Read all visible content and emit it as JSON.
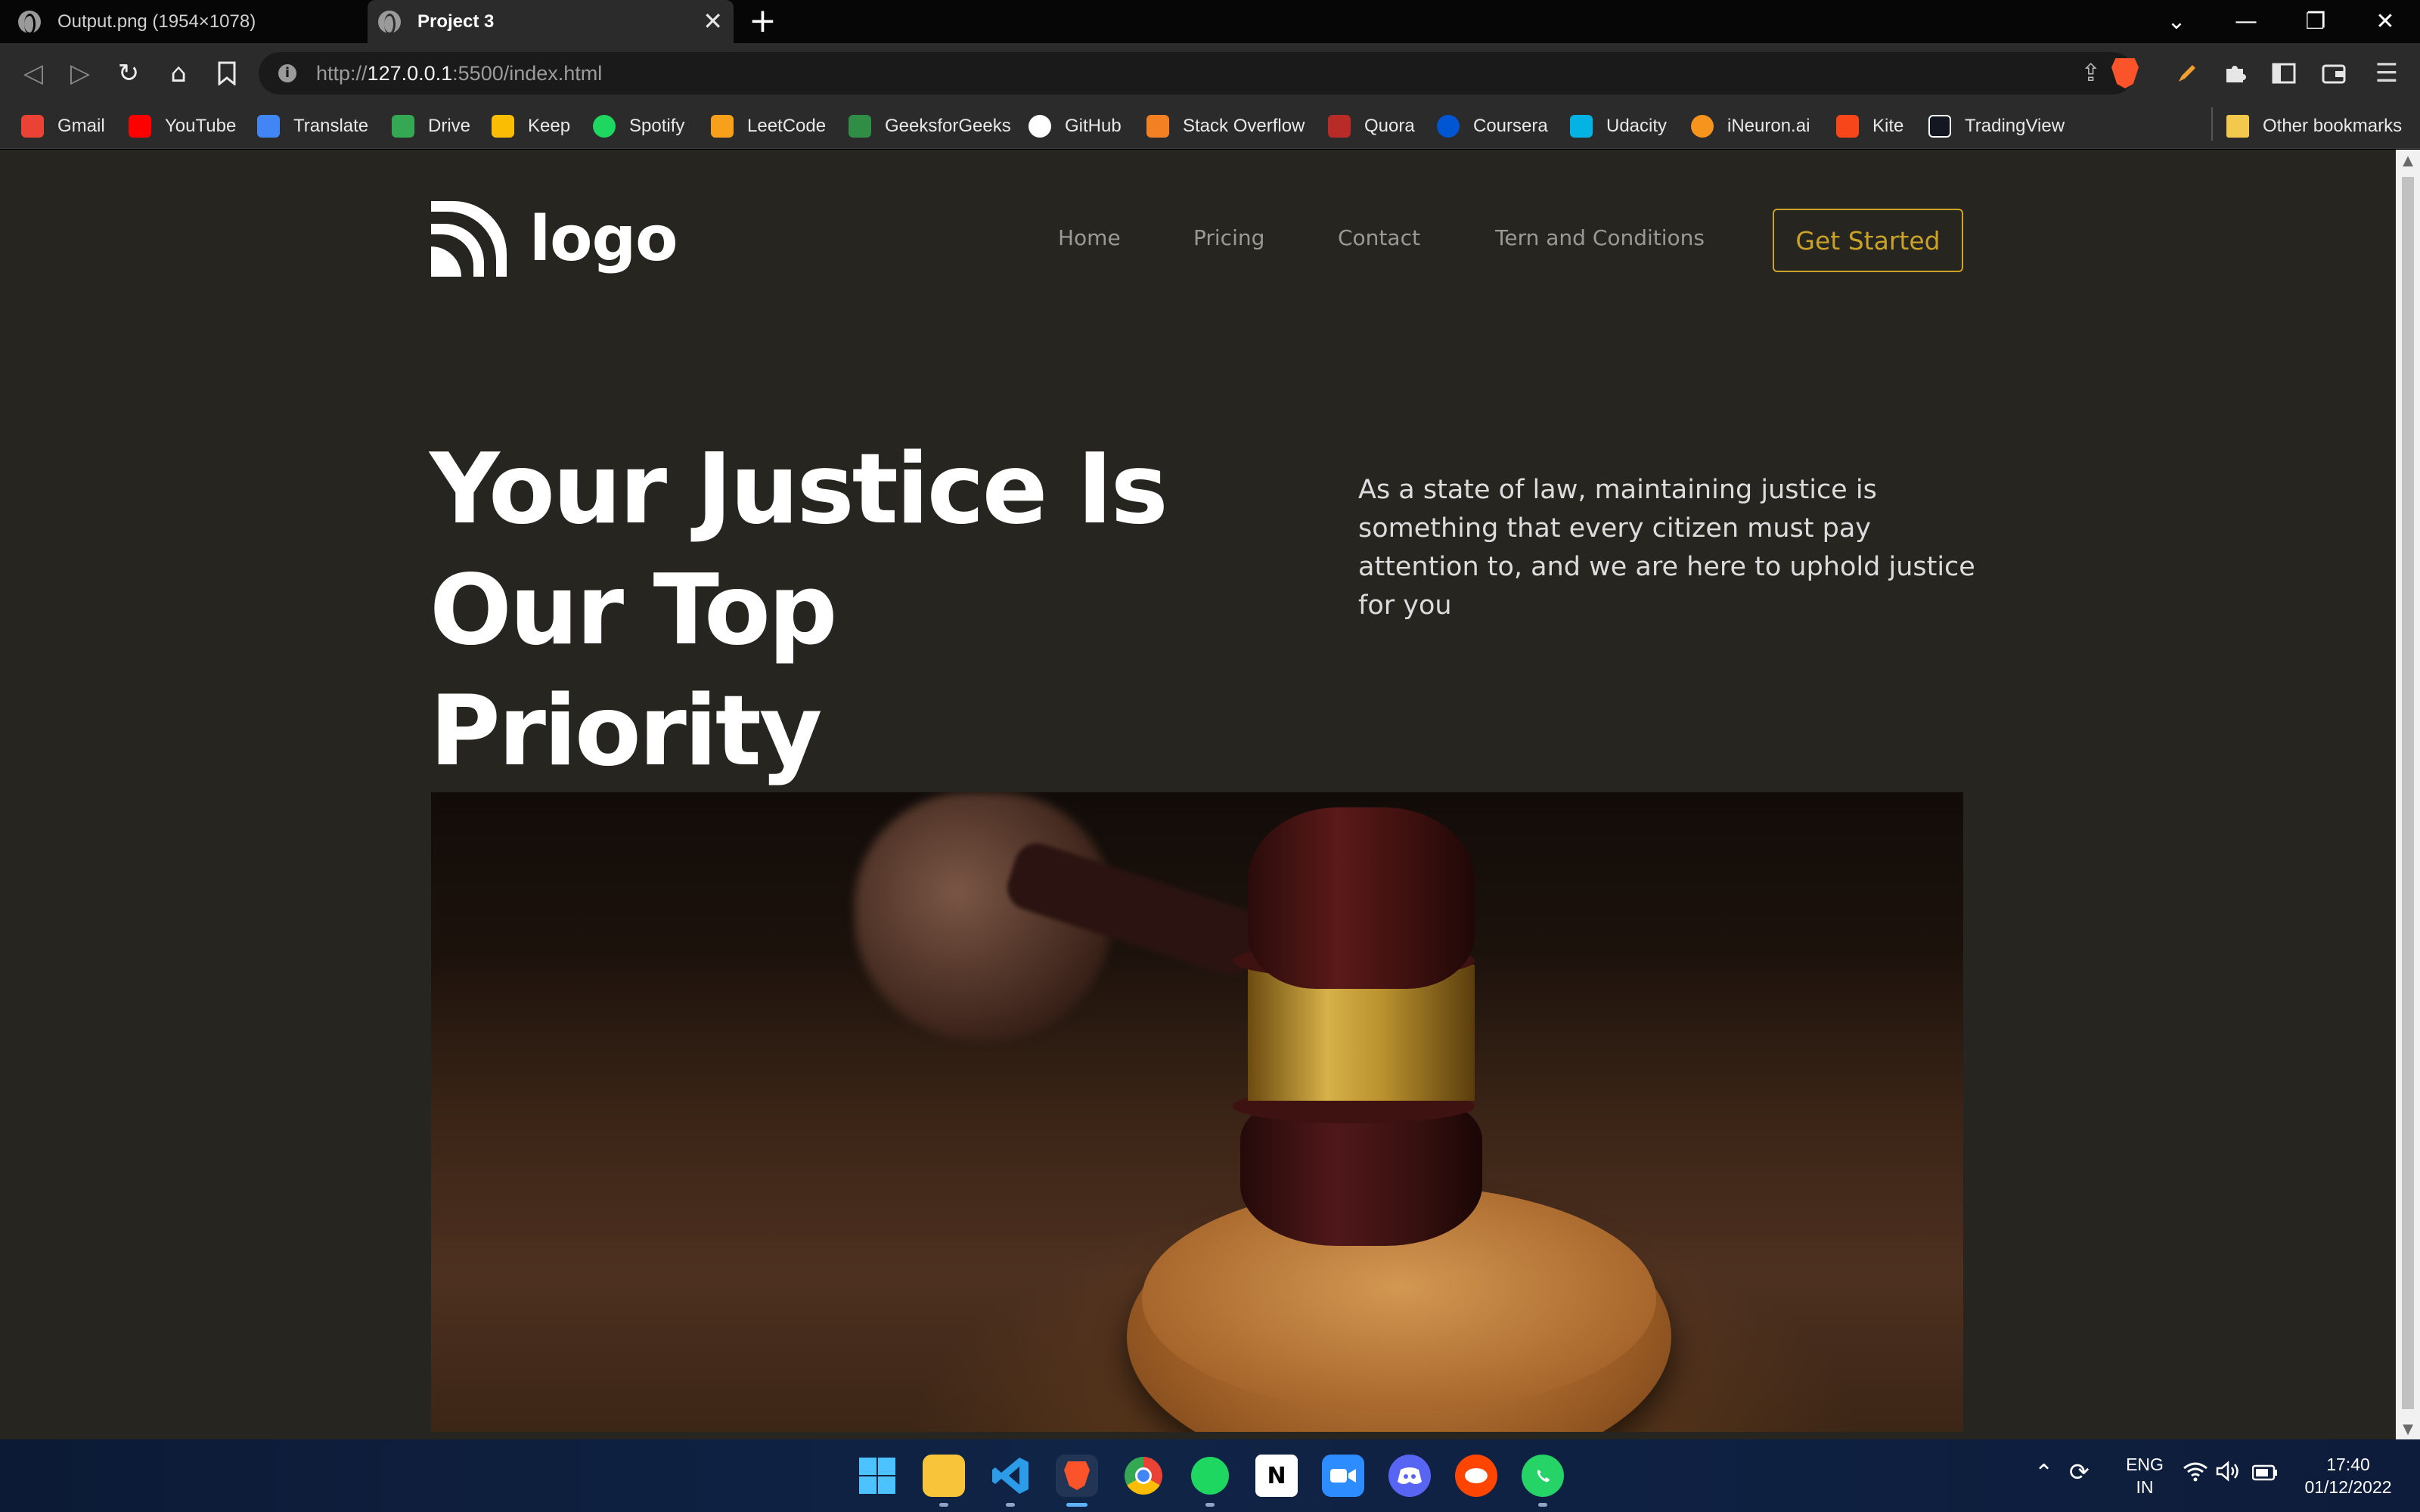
{
  "tabs": [
    {
      "title": "Output.png (1954×1078)",
      "active": false
    },
    {
      "title": "Project 3",
      "active": true
    }
  ],
  "tab_close": "✕",
  "new_tab": "+",
  "window_controls": {
    "dropdown": "⌄",
    "minimize": "—",
    "restore": "❐",
    "close": "✕"
  },
  "address": {
    "host": "127.0.0.1",
    "prefix": "http://",
    "suffix": ":5500/index.html"
  },
  "toolbar_icons": {
    "back": "◁",
    "forward": "▷",
    "reload": "↻",
    "home": "⌂",
    "bookmark": "🔖",
    "share": "⇪",
    "menu": "☰"
  },
  "bookmarks": [
    {
      "label": "Gmail",
      "color": "#ea4335"
    },
    {
      "label": "YouTube",
      "color": "#ff0000"
    },
    {
      "label": "Translate",
      "color": "#4285f4"
    },
    {
      "label": "Drive",
      "color": "#34a853"
    },
    {
      "label": "Keep",
      "color": "#fbbc04"
    },
    {
      "label": "Spotify",
      "color": "#1ed760"
    },
    {
      "label": "LeetCode",
      "color": "#f89f1b"
    },
    {
      "label": "GeeksforGeeks",
      "color": "#2f8d46"
    },
    {
      "label": "GitHub",
      "color": "#ffffff"
    },
    {
      "label": "Stack Overflow",
      "color": "#f48024"
    },
    {
      "label": "Quora",
      "color": "#b92b27"
    },
    {
      "label": "Coursera",
      "color": "#0056d2"
    },
    {
      "label": "Udacity",
      "color": "#02b3e4"
    },
    {
      "label": "iNeuron.ai",
      "color": "#f7941d"
    },
    {
      "label": "Kite",
      "color": "#f6461a"
    },
    {
      "label": "TradingView",
      "color": "#131722"
    }
  ],
  "other_bookmarks": "Other bookmarks",
  "site": {
    "logo_text": "logo",
    "nav": [
      "Home",
      "Pricing",
      "Contact",
      "Tern and Conditions"
    ],
    "cta": "Get Started",
    "hero_title_line1": "Your Justice Is",
    "hero_title_line2": "Our Top Priority",
    "hero_desc": "As a state of law, maintaining justice is something that every citizen must pay attention to, and we are here to uphold justice for you",
    "accent": "#c9a227",
    "background": "#262520"
  },
  "taskbar": {
    "apps": [
      "windows-start",
      "file-explorer",
      "vscode",
      "brave",
      "chrome",
      "spotify",
      "notion",
      "zoom",
      "discord",
      "reddit",
      "whatsapp"
    ],
    "language_line1": "ENG",
    "language_line2": "IN",
    "time": "17:40",
    "date": "01/12/2022"
  }
}
